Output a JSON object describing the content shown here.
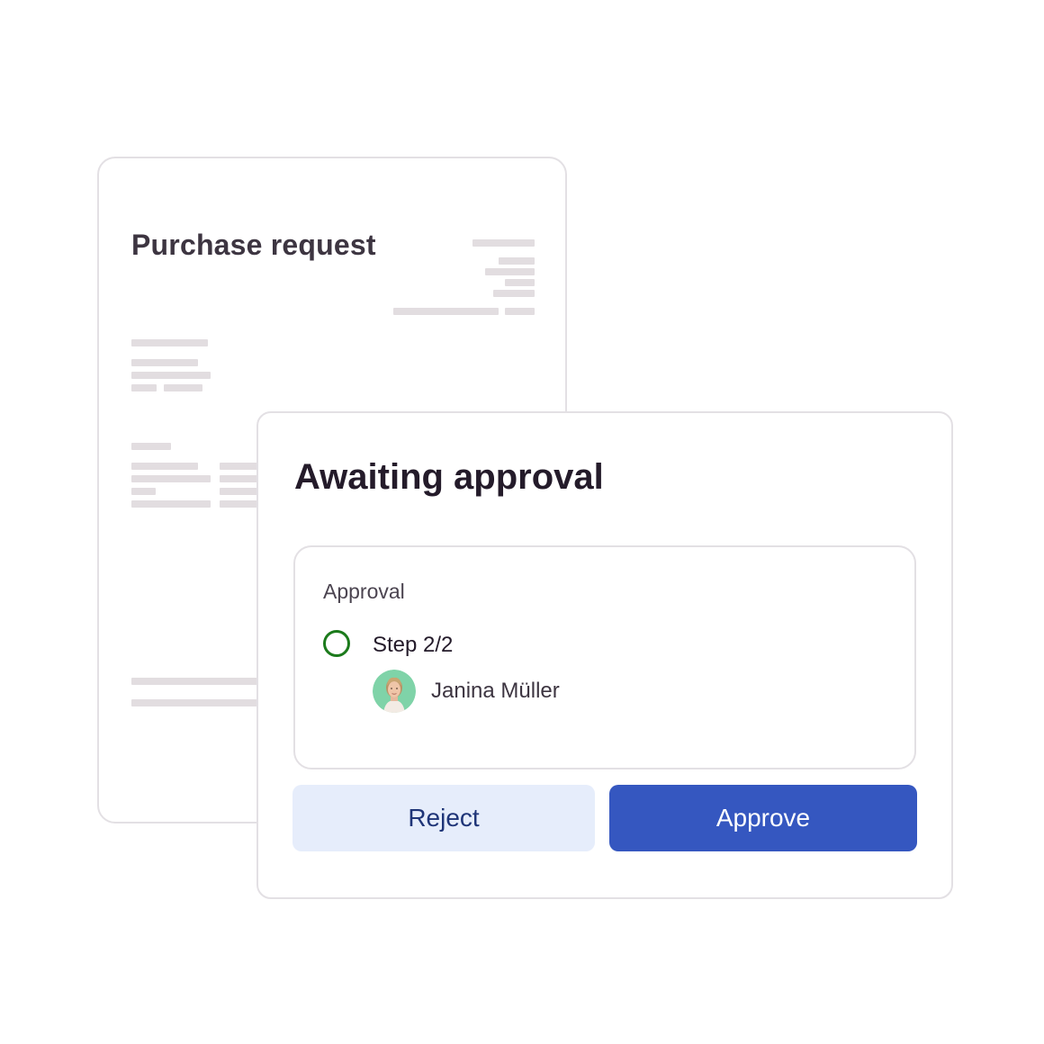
{
  "document": {
    "title": "Purchase request"
  },
  "approval_panel": {
    "title": "Awaiting approval",
    "section_label": "Approval",
    "step": {
      "label": "Step 2/2",
      "status_color": "#1b7a1b"
    },
    "approver": {
      "name": "Janina Müller",
      "avatar_bg": "#7fd3a8"
    },
    "reject_label": "Reject",
    "approve_label": "Approve"
  },
  "colors": {
    "approve_button": "#3557c0",
    "reject_button": "#e6edfb",
    "placeholder_lines": "#e2dde0"
  }
}
